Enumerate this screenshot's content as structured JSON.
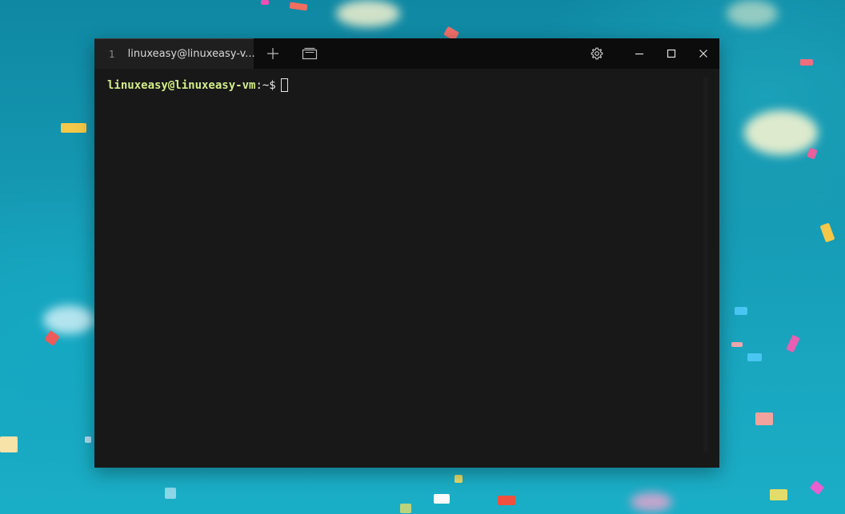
{
  "tab": {
    "number": "1",
    "title": "linuxeasy@linuxeasy-v..."
  },
  "titlebar": {
    "new_tab_icon": "plus-icon",
    "tab_view_icon": "tab-switcher-icon",
    "settings_icon": "gear-icon",
    "minimize_icon": "minimize-icon",
    "maximize_icon": "maximize-icon",
    "close_icon": "close-icon"
  },
  "terminal": {
    "prompt_user_host": "linuxeasy@linuxeasy-vm",
    "prompt_path": ":~$"
  },
  "colors": {
    "prompt_user_host": "#d2ec8a",
    "terminal_bg": "#181818",
    "titlebar_bg": "#0c0c0c"
  }
}
